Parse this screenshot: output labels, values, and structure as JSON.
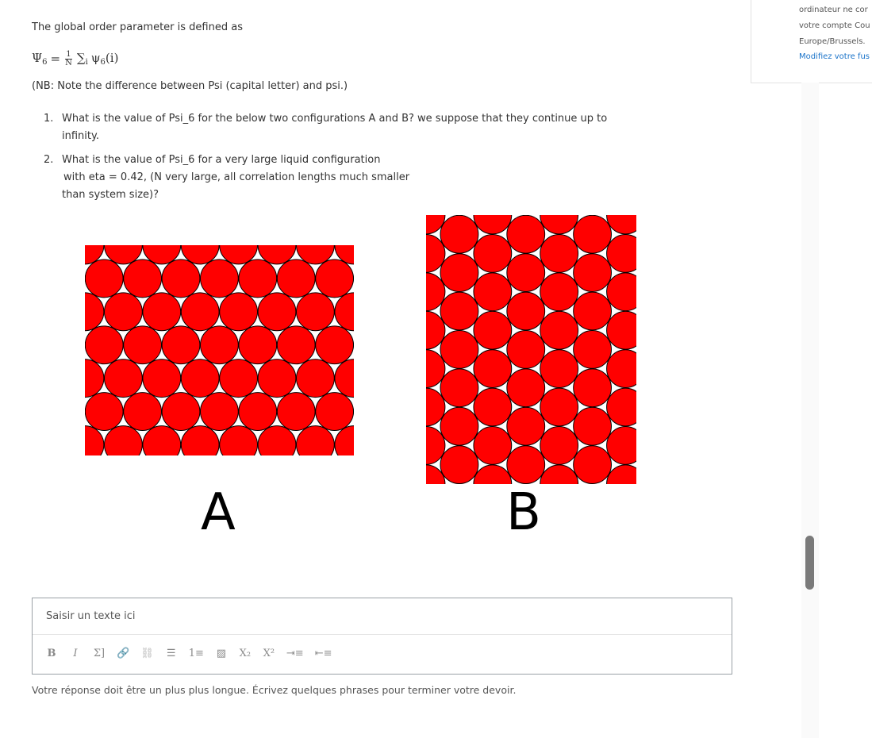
{
  "question": {
    "intro": "The global order parameter is defined as",
    "formula": {
      "lhs": "Ψ",
      "lhs_sub": "6",
      "eq": "=",
      "frac_num": "1",
      "frac_den": "N",
      "sum": "∑",
      "sum_sub": "i",
      "term": "ψ",
      "term_sub": "6",
      "arg": "(i)"
    },
    "nb": "(NB: Note the difference between Psi (capital letter) and psi.)",
    "items": [
      {
        "num": "1.",
        "line1": "What is the value of Psi_6 for the below two configurations A and B? we suppose that they continue up to infinity.",
        "line2": "",
        "line3": ""
      },
      {
        "num": "2.",
        "line1": "What is the value of Psi_6 for a very large liquid configuration",
        "line2": " with eta = 0.42, (N very large, all correlation lengths much smaller",
        "line3": "than system size)?"
      }
    ]
  },
  "figures": {
    "A": {
      "label": "A",
      "fill": "#ff0000",
      "stroke": "#000000"
    },
    "B": {
      "label": "B",
      "fill": "#ff0000",
      "stroke": "#000000"
    }
  },
  "answer": {
    "placeholder": "Saisir un texte ici",
    "toolbar": [
      {
        "name": "bold-button",
        "glyph": "B"
      },
      {
        "name": "italic-button",
        "glyph": "I"
      },
      {
        "name": "formula-button",
        "glyph": "Σ]"
      },
      {
        "name": "link-button",
        "glyph": "🔗"
      },
      {
        "name": "unlink-button",
        "glyph": "⛓"
      },
      {
        "name": "bullet-list-button",
        "glyph": "☰"
      },
      {
        "name": "numbered-list-button",
        "glyph": "1≡"
      },
      {
        "name": "image-button",
        "glyph": "▨"
      },
      {
        "name": "subscript-button",
        "glyph": "X₂"
      },
      {
        "name": "superscript-button",
        "glyph": "X²"
      },
      {
        "name": "indent-button",
        "glyph": "⇥≡"
      },
      {
        "name": "outdent-button",
        "glyph": "⇤≡"
      }
    ],
    "hint": "Votre réponse doit être un plus plus longue. Écrivez quelques phrases pour terminer votre devoir."
  },
  "side_notice": {
    "line1": "ordinateur ne cor",
    "line2": "votre compte Cou",
    "line3": "Europe/Brussels.",
    "link": "Modifiez votre fus",
    "icon": "warning-icon"
  }
}
